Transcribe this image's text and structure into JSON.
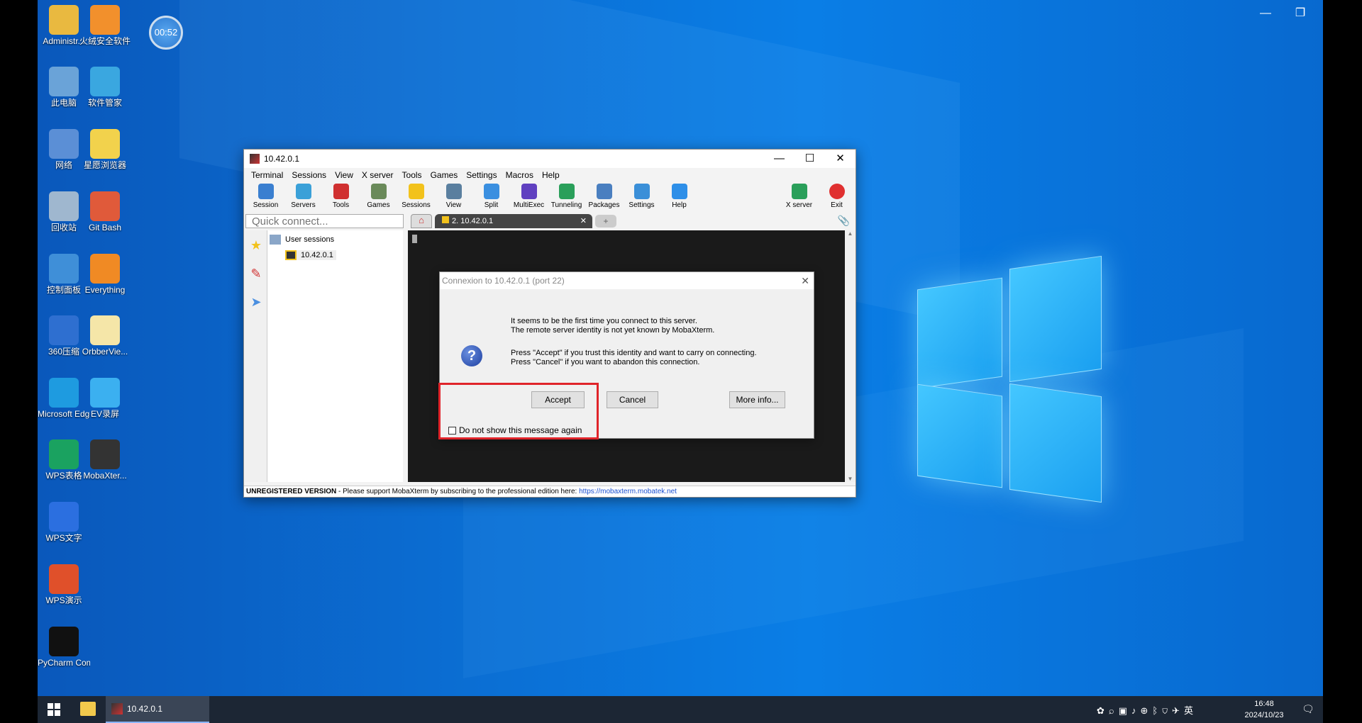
{
  "desktop": {
    "timer": "00:52",
    "icons": [
      {
        "label": "Administr...",
        "color": "#e9b940"
      },
      {
        "label": "火绒安全软件",
        "color": "#f2902c"
      },
      {
        "label": "此电脑",
        "color": "#6aa3d8"
      },
      {
        "label": "软件管家",
        "color": "#3aa7e0"
      },
      {
        "label": "网络",
        "color": "#5b8fd6"
      },
      {
        "label": "星愿浏览器",
        "color": "#f2d24c"
      },
      {
        "label": "回收站",
        "color": "#9fb7cf"
      },
      {
        "label": "Git Bash",
        "color": "#e05a3a"
      },
      {
        "label": "控制面板",
        "color": "#3f8fd8"
      },
      {
        "label": "Everything",
        "color": "#f08a24"
      },
      {
        "label": "360压缩",
        "color": "#2e6fd0"
      },
      {
        "label": "OrbberVie...",
        "color": "#f5e6a8"
      },
      {
        "label": "Microsoft Edge",
        "color": "#1e9be0"
      },
      {
        "label": "EV录屏",
        "color": "#3bb0f0"
      },
      {
        "label": "WPS表格",
        "color": "#1aa260"
      },
      {
        "label": "MobaXter...",
        "color": "#333333"
      },
      {
        "label": "WPS文字",
        "color": "#2b6fe0"
      },
      {
        "label": "WPS演示",
        "color": "#e0502a"
      },
      {
        "label": "PyCharm Communi...",
        "color": "#111111"
      }
    ]
  },
  "window": {
    "title": "10.42.0.1",
    "menu": [
      "Terminal",
      "Sessions",
      "View",
      "X server",
      "Tools",
      "Games",
      "Settings",
      "Macros",
      "Help"
    ],
    "toolbar": [
      {
        "label": "Session",
        "color": "#3a7fd0"
      },
      {
        "label": "Servers",
        "color": "#3aa0d8"
      },
      {
        "label": "Tools",
        "color": "#d03030"
      },
      {
        "label": "Games",
        "color": "#6a8a5a"
      },
      {
        "label": "Sessions",
        "color": "#f2c21c"
      },
      {
        "label": "View",
        "color": "#5a7f9f"
      },
      {
        "label": "Split",
        "color": "#3a8fe0"
      },
      {
        "label": "MultiExec",
        "color": "#6040c0"
      },
      {
        "label": "Tunneling",
        "color": "#2a9f5a"
      },
      {
        "label": "Packages",
        "color": "#4a7fc0"
      },
      {
        "label": "Settings",
        "color": "#3a8fd8"
      },
      {
        "label": "Help",
        "color": "#2e8fe8"
      }
    ],
    "toolbar_right": [
      {
        "label": "X server",
        "color": "#2a9f5a"
      },
      {
        "label": "Exit",
        "color": "#e03030"
      }
    ],
    "quick_connect_placeholder": "Quick connect...",
    "tab_label": "2. 10.42.0.1",
    "tree": {
      "group": "User sessions",
      "item": "10.42.0.1"
    },
    "status": {
      "unregistered": "UNREGISTERED VERSION",
      "message": " -  Please support MobaXterm by subscribing to the professional edition here: ",
      "link": "https://mobaxterm.mobatek.net"
    }
  },
  "dialog": {
    "title": "Connexion to 10.42.0.1 (port 22)",
    "line1": "It seems to be the first time you connect to this server.",
    "line2": "The remote server identity is not yet known by MobaXterm.",
    "line3": "Press \"Accept\" if you trust this identity and want to carry on connecting.",
    "line4": "Press \"Cancel\" if you want to abandon this connection.",
    "accept": "Accept",
    "cancel": "Cancel",
    "more_info": "More info...",
    "checkbox": "Do not show this message again"
  },
  "taskbar": {
    "app": "10.42.0.1",
    "ime": "英",
    "time": "16:48",
    "date": "2024/10/23"
  }
}
